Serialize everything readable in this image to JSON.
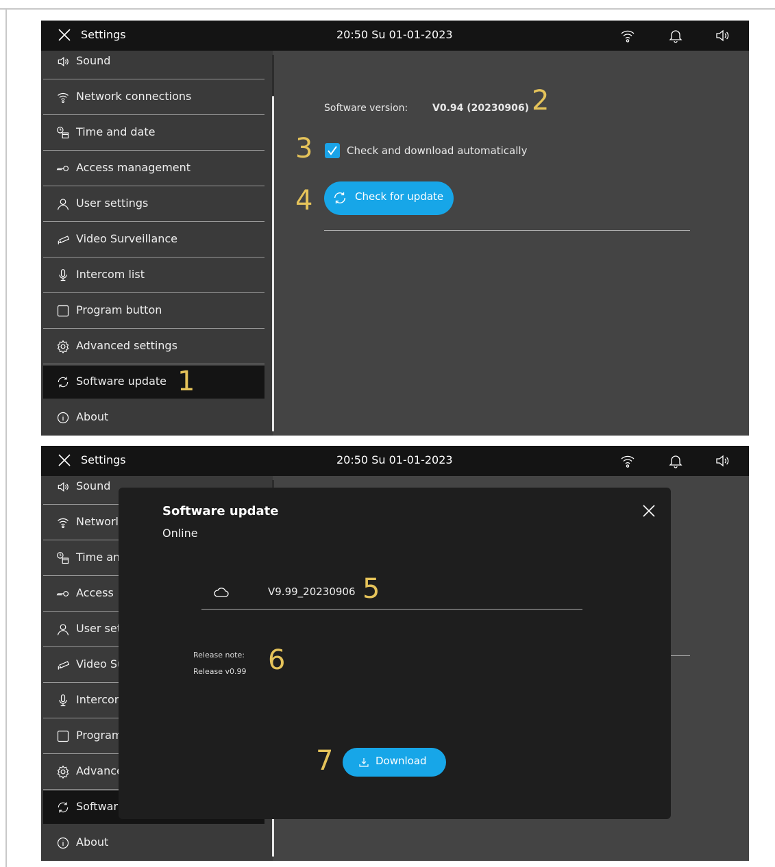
{
  "topbar": {
    "title": "Settings",
    "clock": "20:50  Su 01-01-2023",
    "icons": [
      "close-icon",
      "wifi-icon",
      "bell-icon",
      "speaker-icon"
    ]
  },
  "sidebar": {
    "items": [
      {
        "label": "Sound",
        "icon": "speaker-icon"
      },
      {
        "label": "Network connections",
        "icon": "wifi-icon"
      },
      {
        "label": "Time and date",
        "icon": "clock-calendar-icon"
      },
      {
        "label": "Access  management",
        "icon": "key-icon"
      },
      {
        "label": "User settings",
        "icon": "user-icon"
      },
      {
        "label": "Video Surveillance",
        "icon": "camera-icon"
      },
      {
        "label": "Intercom list",
        "icon": "microphone-icon"
      },
      {
        "label": "Program button",
        "icon": "square-icon"
      },
      {
        "label": "Advanced settings",
        "icon": "gear-icon"
      },
      {
        "label": "Software update",
        "icon": "refresh-icon",
        "active": true
      },
      {
        "label": "About",
        "icon": "info-icon"
      }
    ],
    "truncated_labels": [
      "Sound",
      "Networl",
      "Time an",
      "Access",
      "User set",
      "Video Su",
      "Intercor",
      "Program",
      "Advance",
      "Softwar",
      "About"
    ]
  },
  "main": {
    "software_version_label": "Software version:",
    "software_version_value": "V0.94 (20230906)",
    "auto_check_label": "Check and download automatically",
    "auto_check_checked": true,
    "check_button_label": "Check for update"
  },
  "dialog": {
    "title": "Software update",
    "subtitle": "Online",
    "version": "V9.99_20230906",
    "release_note_label": "Release note:",
    "release_note_text": "Release v0.99",
    "download_button_label": "Download"
  },
  "callouts": [
    "1",
    "2",
    "3",
    "4",
    "5",
    "6",
    "7"
  ],
  "colors": {
    "accent": "#17a6e8",
    "callout": "#e5c35a",
    "topbar": "#141414",
    "sidebar": "#3a3a3a",
    "content": "#444444",
    "dialog": "#1e1e1e"
  }
}
